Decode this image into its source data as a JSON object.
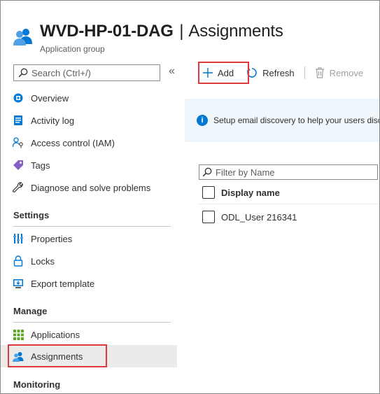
{
  "header": {
    "resource_name": "WVD-HP-01-DAG",
    "separator": "|",
    "page_title": "Assignments",
    "subtitle": "Application group"
  },
  "sidebar": {
    "search_placeholder": "Search (Ctrl+/)",
    "collapse_glyph": "«",
    "items_top": [
      {
        "label": "Overview",
        "icon": "overview-icon"
      },
      {
        "label": "Activity log",
        "icon": "activity-log-icon"
      },
      {
        "label": "Access control (IAM)",
        "icon": "iam-icon"
      },
      {
        "label": "Tags",
        "icon": "tag-icon"
      },
      {
        "label": "Diagnose and solve problems",
        "icon": "wrench-icon"
      }
    ],
    "settings": {
      "title": "Settings",
      "items": [
        {
          "label": "Properties",
          "icon": "properties-icon"
        },
        {
          "label": "Locks",
          "icon": "lock-icon"
        },
        {
          "label": "Export template",
          "icon": "export-template-icon"
        }
      ]
    },
    "manage": {
      "title": "Manage",
      "items": [
        {
          "label": "Applications",
          "icon": "applications-icon"
        },
        {
          "label": "Assignments",
          "icon": "assignments-icon",
          "active": true
        }
      ]
    },
    "monitoring": {
      "title": "Monitoring"
    }
  },
  "toolbar": {
    "add_label": "Add",
    "refresh_label": "Refresh",
    "remove_label": "Remove"
  },
  "banner": {
    "text": "Setup email discovery to help your users discover their assigned resources"
  },
  "table": {
    "filter_placeholder": "Filter by Name",
    "column_header": "Display name",
    "rows": [
      {
        "display_name": "ODL_User 216341"
      }
    ]
  },
  "colors": {
    "accent": "#0078d4",
    "highlight_box": "#e0393e",
    "active_bg": "#edebe9",
    "banner_bg": "#eff6fc"
  }
}
